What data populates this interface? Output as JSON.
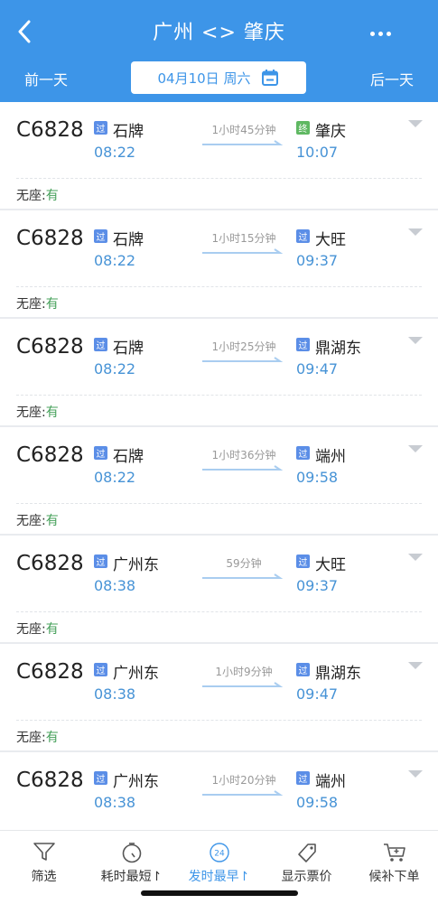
{
  "header": {
    "title": "广州 <> 肇庆",
    "prev_day": "前一天",
    "next_day": "后一天",
    "date": "04月10日",
    "weekday": "周六"
  },
  "trains": [
    {
      "number": "C6828",
      "from_tag": "过",
      "from": "石牌",
      "depart": "08:22",
      "duration": "1小时45分钟",
      "to_tag": "终",
      "to": "肇庆",
      "arrive": "10:07",
      "seat_label": "无座:",
      "seat_value": "有"
    },
    {
      "number": "C6828",
      "from_tag": "过",
      "from": "石牌",
      "depart": "08:22",
      "duration": "1小时15分钟",
      "to_tag": "过",
      "to": "大旺",
      "arrive": "09:37",
      "seat_label": "无座:",
      "seat_value": "有"
    },
    {
      "number": "C6828",
      "from_tag": "过",
      "from": "石牌",
      "depart": "08:22",
      "duration": "1小时25分钟",
      "to_tag": "过",
      "to": "鼎湖东",
      "arrive": "09:47",
      "seat_label": "无座:",
      "seat_value": "有"
    },
    {
      "number": "C6828",
      "from_tag": "过",
      "from": "石牌",
      "depart": "08:22",
      "duration": "1小时36分钟",
      "to_tag": "过",
      "to": "端州",
      "arrive": "09:58",
      "seat_label": "无座:",
      "seat_value": "有"
    },
    {
      "number": "C6828",
      "from_tag": "过",
      "from": "广州东",
      "depart": "08:38",
      "duration": "59分钟",
      "to_tag": "过",
      "to": "大旺",
      "arrive": "09:37",
      "seat_label": "无座:",
      "seat_value": "有"
    },
    {
      "number": "C6828",
      "from_tag": "过",
      "from": "广州东",
      "depart": "08:38",
      "duration": "1小时9分钟",
      "to_tag": "过",
      "to": "鼎湖东",
      "arrive": "09:47",
      "seat_label": "无座:",
      "seat_value": "有"
    },
    {
      "number": "C6828",
      "from_tag": "过",
      "from": "广州东",
      "depart": "08:38",
      "duration": "1小时20分钟",
      "to_tag": "过",
      "to": "端州",
      "arrive": "09:58",
      "seat_label": "",
      "seat_value": ""
    }
  ],
  "tabs": [
    {
      "label": "筛选",
      "icon": "filter-icon"
    },
    {
      "label": "耗时最短↾",
      "icon": "stopwatch-icon"
    },
    {
      "label": "发时最早↾",
      "icon": "clock-24-icon",
      "icon_text": "24"
    },
    {
      "label": "显示票价",
      "icon": "price-tag-icon"
    },
    {
      "label": "候补下单",
      "icon": "cart-icon"
    }
  ],
  "colors": {
    "header": "#3d95e8",
    "time": "#4793d6",
    "seat_value": "#45a05a",
    "pass_badge": "#5b8ee7",
    "end_badge": "#5fb862"
  }
}
